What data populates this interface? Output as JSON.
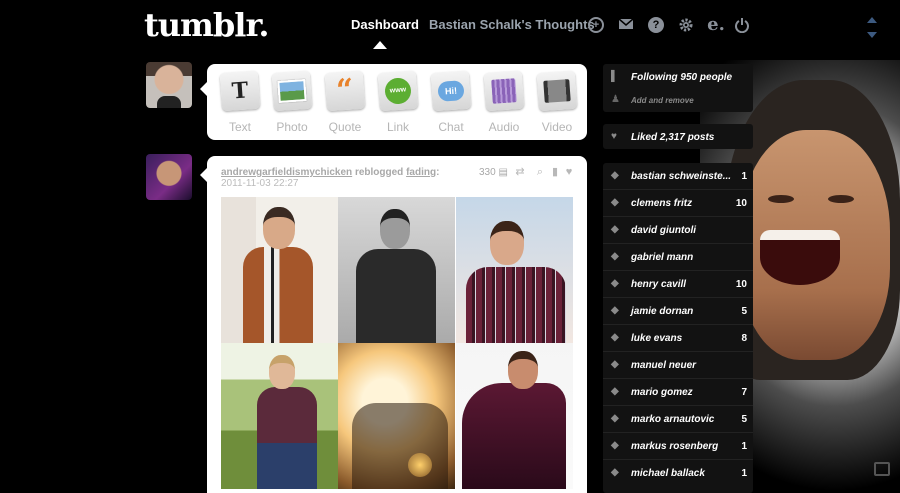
{
  "header": {
    "logo": "tumblr.",
    "tabs": [
      {
        "label": "Dashboard"
      },
      {
        "label": "Bastian Schalk's Thoughts"
      }
    ],
    "icons": [
      "new-post-icon",
      "inbox-icon",
      "help-icon",
      "settings-icon",
      "edit-icon",
      "logout-icon"
    ]
  },
  "composer": {
    "types": [
      {
        "label": "Text",
        "icon": "text-icon"
      },
      {
        "label": "Photo",
        "icon": "photo-icon"
      },
      {
        "label": "Quote",
        "icon": "quote-icon"
      },
      {
        "label": "Link",
        "icon": "link-icon"
      },
      {
        "label": "Chat",
        "icon": "chat-icon"
      },
      {
        "label": "Audio",
        "icon": "audio-icon"
      },
      {
        "label": "Video",
        "icon": "video-icon"
      }
    ]
  },
  "post": {
    "author": "andrewgarfieldismychicken",
    "action": "reblogged",
    "source": "fading",
    "source_suffix": ":",
    "date": "2011-11-03 22:27",
    "notes": "330"
  },
  "sidebar": {
    "following": "Following 950 people",
    "add_remove": "Add and remove",
    "liked": "Liked 2,317 posts",
    "tags": [
      {
        "label": "bastian schweinste...",
        "count": "1"
      },
      {
        "label": "clemens fritz",
        "count": "10"
      },
      {
        "label": "david giuntoli",
        "count": ""
      },
      {
        "label": "gabriel mann",
        "count": ""
      },
      {
        "label": "henry cavill",
        "count": "10"
      },
      {
        "label": "jamie dornan",
        "count": "5"
      },
      {
        "label": "luke evans",
        "count": "8"
      },
      {
        "label": "manuel neuer",
        "count": ""
      },
      {
        "label": "mario gomez",
        "count": "7"
      },
      {
        "label": "marko arnautovic",
        "count": "5"
      },
      {
        "label": "markus rosenberg",
        "count": "1"
      },
      {
        "label": "michael ballack",
        "count": "1"
      }
    ]
  }
}
